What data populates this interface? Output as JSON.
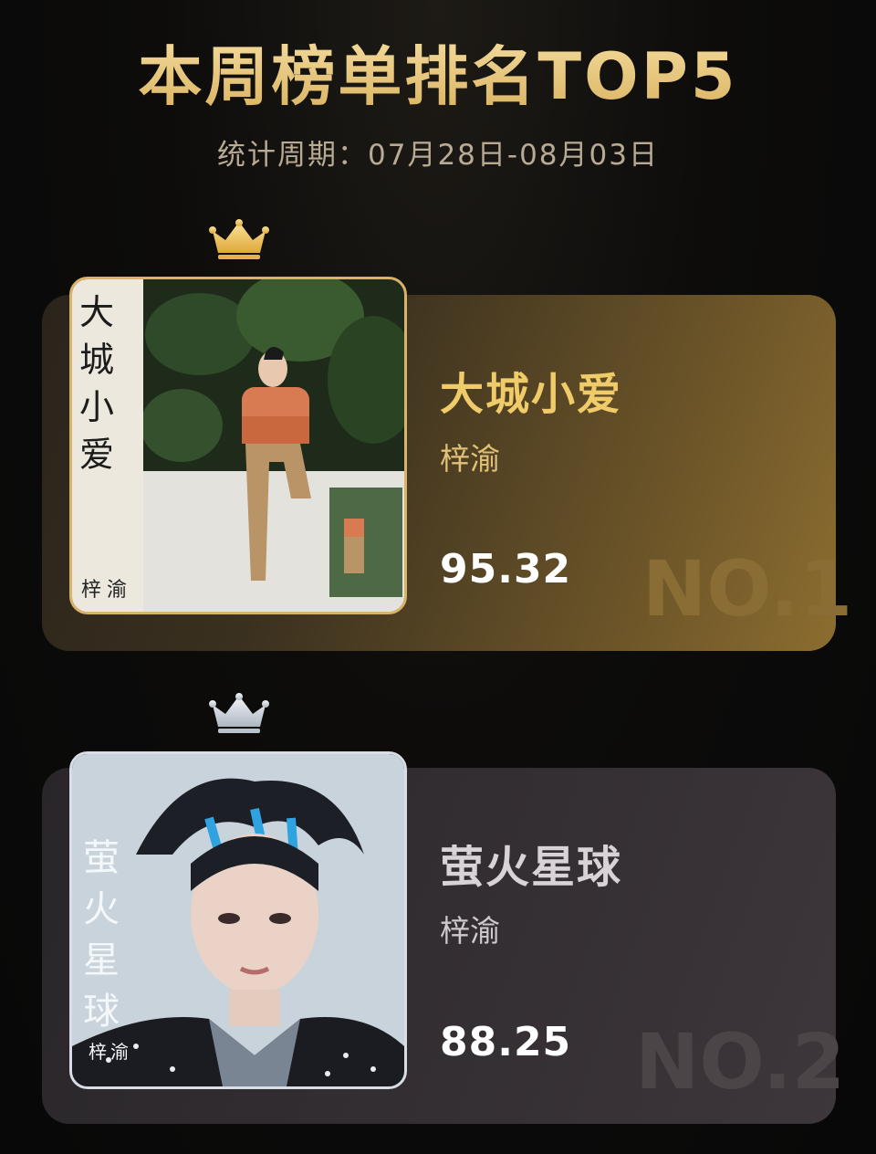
{
  "header": {
    "title": "本周榜单排名TOP5",
    "period": "统计周期：07月28日-08月03日"
  },
  "entries": [
    {
      "song": "大城小爱",
      "artist": "梓渝",
      "score": "95.32",
      "rank": "NO.1",
      "crown": "gold-crown-icon",
      "cover_text": "大城小爱",
      "cover_artist": "梓渝",
      "colors": {
        "song": "#f0cb6a",
        "artist": "#e0c177",
        "rank": "#8a6d34"
      }
    },
    {
      "song": "萤火星球",
      "artist": "梓渝",
      "score": "88.25",
      "rank": "NO.2",
      "crown": "silver-crown-icon",
      "cover_text": "萤火星球",
      "cover_artist": "梓渝",
      "colors": {
        "song": "#d9d3d7",
        "artist": "#cfc8cc",
        "rank": "#4b4548"
      }
    }
  ]
}
